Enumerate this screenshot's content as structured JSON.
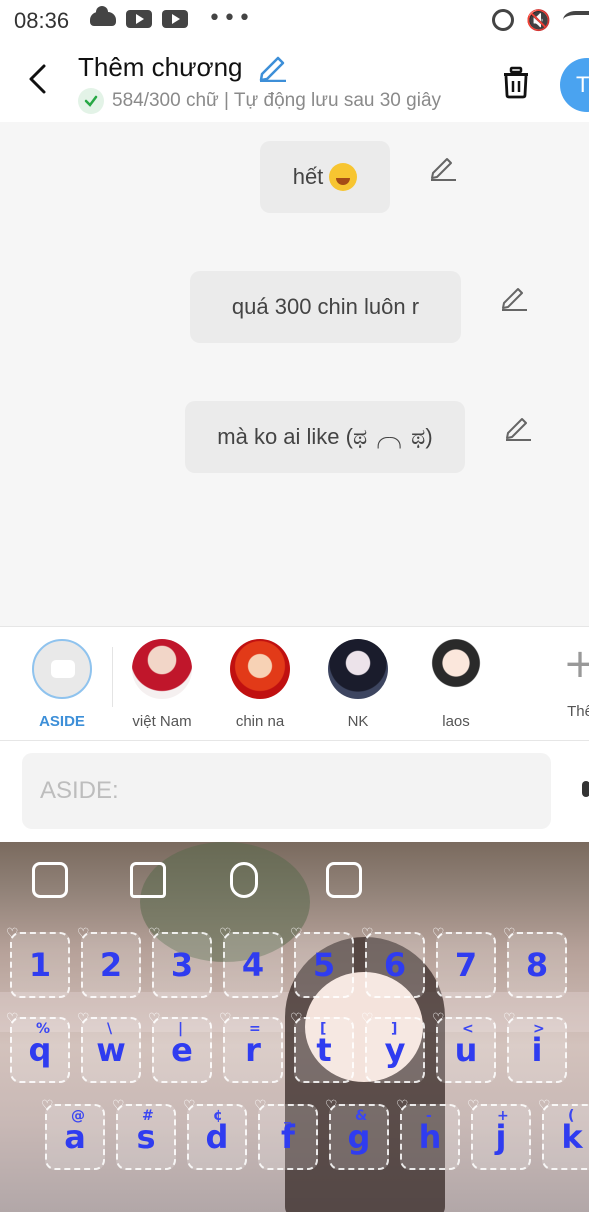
{
  "status_bar": {
    "time": "08:36"
  },
  "header": {
    "title": "Thêm chương",
    "subtitle": "584/300 chữ | Tự động lưu sau 30 giây",
    "avatar_initial": "T"
  },
  "messages": [
    {
      "text": "hết"
    },
    {
      "text": "quá 300 chin luôn r"
    },
    {
      "text": "mà ko ai like (ಥ╭╮ಥ)"
    }
  ],
  "characters": [
    {
      "name": "ASIDE",
      "selected": true
    },
    {
      "name": "việt Nam"
    },
    {
      "name": "chin na"
    },
    {
      "name": "NK"
    },
    {
      "name": "laos"
    }
  ],
  "add_character_label": "Thê",
  "input": {
    "placeholder": "ASIDE:",
    "value": ""
  },
  "keyboard": {
    "number_row": [
      "1",
      "2",
      "3",
      "4",
      "5",
      "6",
      "7",
      "8"
    ],
    "top_row": [
      {
        "key": "q",
        "sup": "%"
      },
      {
        "key": "w",
        "sup": "\\"
      },
      {
        "key": "e",
        "sup": "|"
      },
      {
        "key": "r",
        "sup": "="
      },
      {
        "key": "t",
        "sup": "["
      },
      {
        "key": "y",
        "sup": "]"
      },
      {
        "key": "u",
        "sup": "<"
      },
      {
        "key": "i",
        "sup": ">"
      }
    ],
    "middle_row": [
      {
        "key": "a",
        "sup": "@"
      },
      {
        "key": "s",
        "sup": "#"
      },
      {
        "key": "d",
        "sup": "¢"
      },
      {
        "key": "f",
        "sup": "_"
      },
      {
        "key": "g",
        "sup": "&"
      },
      {
        "key": "h",
        "sup": "-"
      },
      {
        "key": "j",
        "sup": "+"
      },
      {
        "key": "k",
        "sup": "("
      }
    ]
  }
}
